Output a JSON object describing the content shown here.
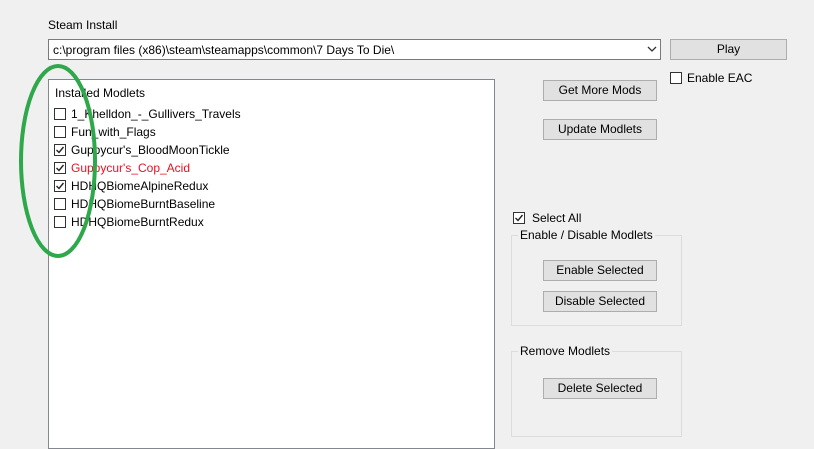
{
  "steam_install": {
    "label": "Steam Install",
    "path": "c:\\program files (x86)\\steam\\steamapps\\common\\7 Days To Die\\",
    "play_label": "Play",
    "enable_eac_label": "Enable EAC",
    "enable_eac_checked": false
  },
  "actions": {
    "get_more_mods_label": "Get More Mods",
    "update_modlets_label": "Update Modlets"
  },
  "installed_modlets": {
    "title": "Installed Modlets",
    "items": [
      {
        "name": "1_Khelldon_-_Gullivers_Travels",
        "checked": false,
        "error": false
      },
      {
        "name": "Fun_with_Flags",
        "checked": false,
        "error": false
      },
      {
        "name": "Guppycur's_BloodMoonTickle",
        "checked": true,
        "error": false
      },
      {
        "name": "Guppycur's_Cop_Acid",
        "checked": true,
        "error": true
      },
      {
        "name": "HDHQBiomeAlpineRedux",
        "checked": true,
        "error": false
      },
      {
        "name": "HDHQBiomeBurntBaseline",
        "checked": false,
        "error": false
      },
      {
        "name": "HDHQBiomeBurntRedux",
        "checked": false,
        "error": false
      }
    ]
  },
  "select_all": {
    "label": "Select All",
    "checked": true
  },
  "enable_disable_group": {
    "title": "Enable / Disable Modlets",
    "enable_label": "Enable Selected",
    "disable_label": "Disable Selected"
  },
  "remove_group": {
    "title": "Remove Modlets",
    "delete_label": "Delete Selected"
  },
  "colors": {
    "error_text": "#e81123",
    "annotation_circle": "#2ea84a"
  }
}
